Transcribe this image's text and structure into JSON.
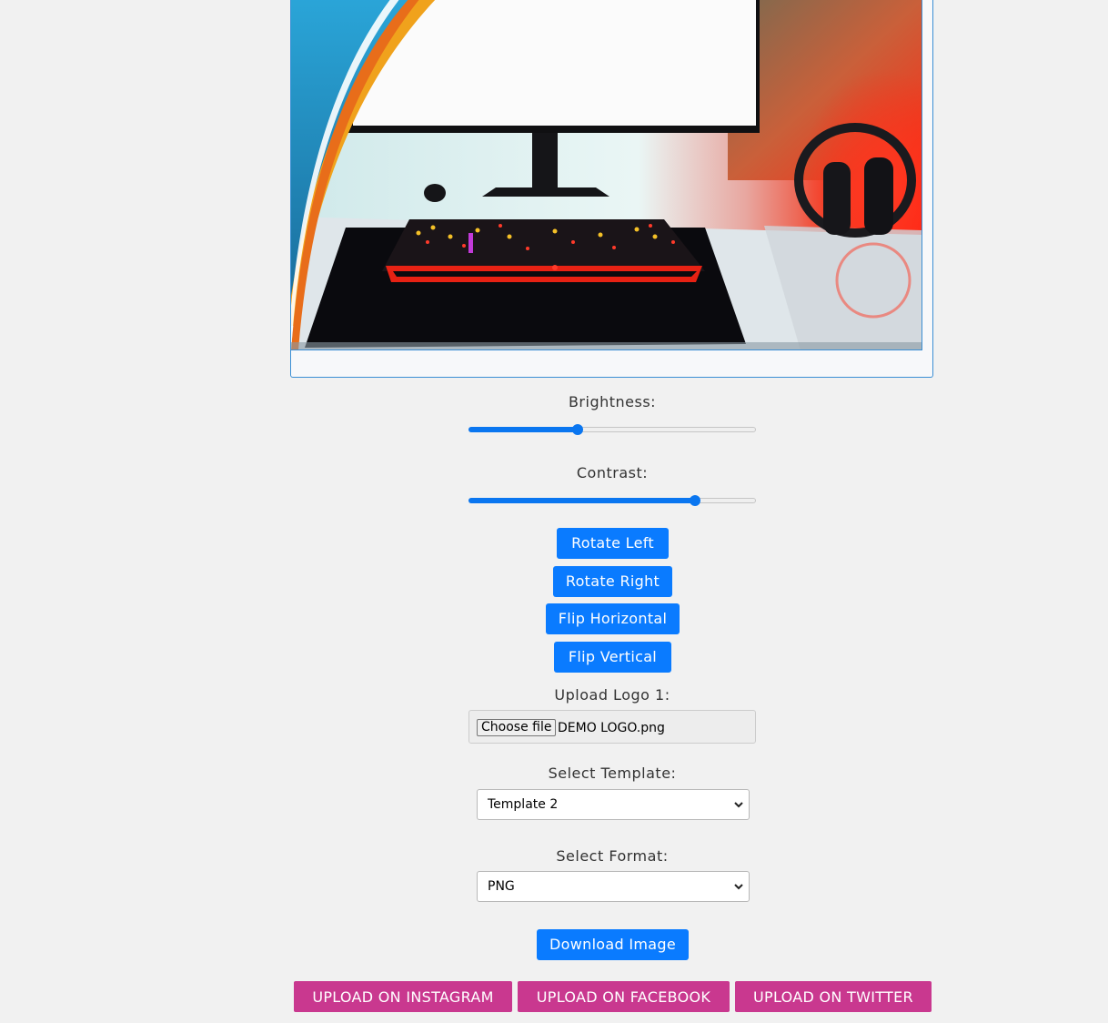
{
  "preview": {
    "image_alt": "Gaming desk with monitor, RGB keyboard and headphones"
  },
  "controls": {
    "brightness": {
      "label": "Brightness:",
      "value": 0.38
    },
    "contrast": {
      "label": "Contrast:",
      "value": 0.79
    }
  },
  "buttons": {
    "rotate_left": "Rotate Left",
    "rotate_right": "Rotate Right",
    "flip_horizontal": "Flip Horizontal",
    "flip_vertical": "Flip Vertical",
    "download": "Download Image"
  },
  "logo_upload": {
    "label": "Upload Logo 1:",
    "choose_button": "Choose file",
    "file_name": "DEMO LOGO.png"
  },
  "template_select": {
    "label": "Select Template:",
    "selected": "Template 2"
  },
  "format_select": {
    "label": "Select Format:",
    "selected": "PNG"
  },
  "social": {
    "instagram": "UPLOAD ON INSTAGRAM",
    "facebook": "UPLOAD ON FACEBOOK",
    "twitter": "UPLOAD ON TWITTER"
  },
  "colors": {
    "primary_button": "#0a7bff",
    "social_button": "#c9388f",
    "slider_fill": "#0a76f0",
    "panel_border": "#3b8fd4"
  }
}
